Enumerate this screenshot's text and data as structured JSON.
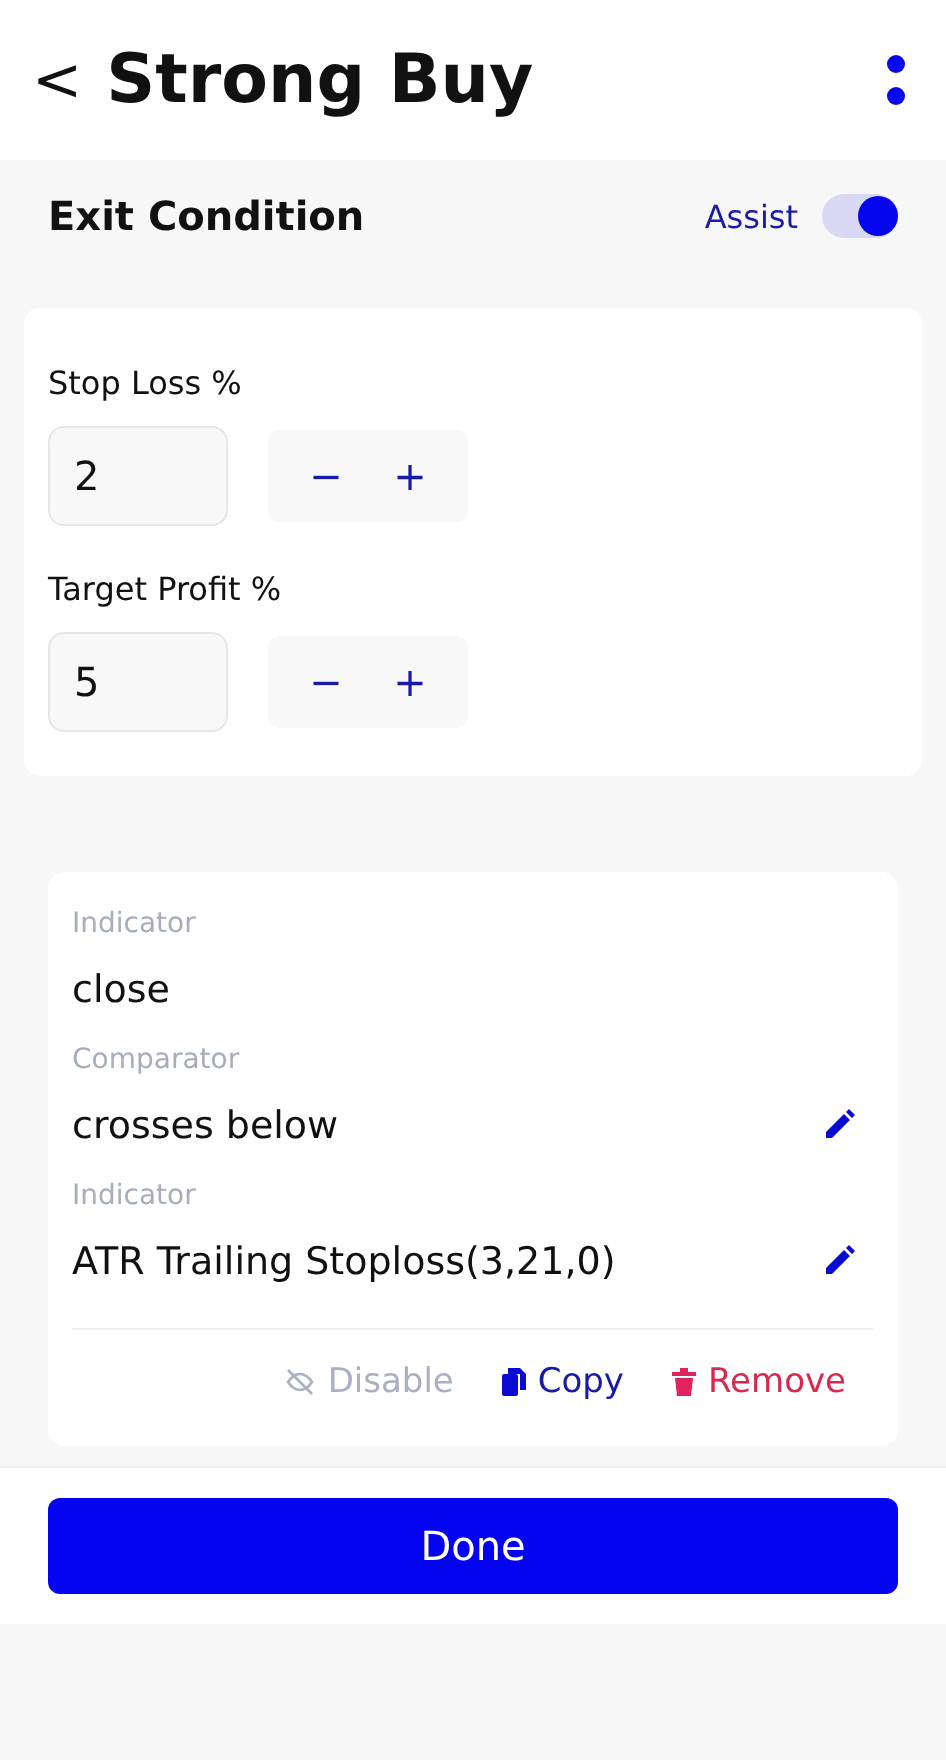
{
  "header": {
    "back": "<",
    "title": "Strong Buy"
  },
  "section": {
    "title": "Exit Condition",
    "assist_label": "Assist",
    "assist_on": true
  },
  "fields": [
    {
      "label": "Stop Loss %",
      "value": "2",
      "minus": "−",
      "plus": "+"
    },
    {
      "label": "Target Profit %",
      "value": "5",
      "minus": "−",
      "plus": "+"
    }
  ],
  "condition": [
    {
      "label": "Indicator",
      "value": "close",
      "editable": false
    },
    {
      "label": "Comparator",
      "value": "crosses below",
      "editable": true
    },
    {
      "label": "Indicator",
      "value": "ATR Trailing Stoploss(3,21,0)",
      "editable": true
    }
  ],
  "actions": [
    {
      "kind": "disable",
      "label": "Disable"
    },
    {
      "kind": "copy",
      "label": "Copy"
    },
    {
      "kind": "remove",
      "label": "Remove"
    }
  ],
  "done": "Done"
}
